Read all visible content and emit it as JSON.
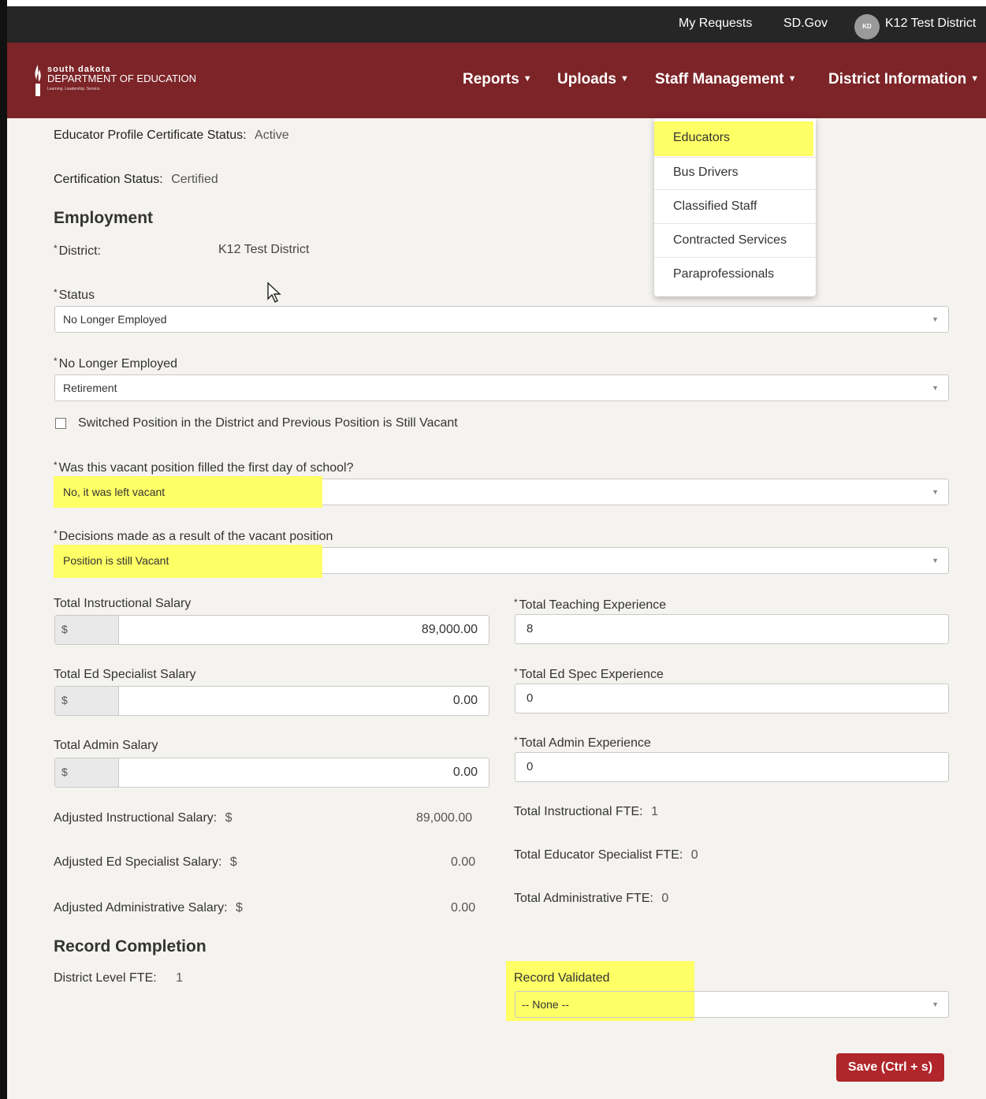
{
  "topbar": {
    "my_requests": "My Requests",
    "sd_gov": "SD.Gov",
    "avatar_initials": "KD",
    "user_name": "K12 Test District"
  },
  "logo": {
    "line1": "south dakota",
    "line2": "DEPARTMENT OF EDUCATION",
    "tagline": "Learning. Leadership. Service."
  },
  "nav": {
    "reports": "Reports",
    "uploads": "Uploads",
    "staff_management": "Staff Management",
    "district_information": "District Information"
  },
  "staff_menu": {
    "items": [
      "Educators",
      "Bus Drivers",
      "Classified Staff",
      "Contracted Services",
      "Paraprofessionals"
    ],
    "highlighted": "Educators"
  },
  "profile": {
    "cert_status_label": "Educator Profile Certificate Status:",
    "cert_status_value": "Active",
    "certification_label": "Certification Status:",
    "certification_value": "Certified"
  },
  "employment": {
    "heading": "Employment",
    "district_label": "District:",
    "district_value": "K12 Test District",
    "status_label": "Status",
    "status_value": "No Longer Employed",
    "nle_label": "No Longer Employed",
    "nle_value": "Retirement",
    "switched_label": "Switched Position in the District and Previous Position is Still Vacant",
    "vacant_filled_label": "Was this vacant position filled the first day of school?",
    "vacant_filled_value": "No, it was left vacant",
    "decisions_label": "Decisions made as a result of the vacant position",
    "decisions_value": "Position is still Vacant"
  },
  "salary": {
    "currency": "$",
    "instructional_label": "Total Instructional Salary",
    "instructional_value": "89,000.00",
    "ed_spec_label": "Total Ed Specialist Salary",
    "ed_spec_value": "0.00",
    "admin_label": "Total Admin Salary",
    "admin_value": "0.00",
    "teaching_exp_label": "Total Teaching Experience",
    "teaching_exp_value": "8",
    "ed_spec_exp_label": "Total Ed Spec Experience",
    "ed_spec_exp_value": "0",
    "admin_exp_label": "Total Admin Experience",
    "admin_exp_value": "0"
  },
  "adjusted": {
    "instructional_label": "Adjusted Instructional Salary:",
    "instructional_value": "89,000.00",
    "ed_spec_label": "Adjusted Ed Specialist Salary:",
    "ed_spec_value": "0.00",
    "admin_label": "Adjusted Administrative Salary:",
    "admin_value": "0.00",
    "currency": "$"
  },
  "fte": {
    "instructional_label": "Total Instructional FTE:",
    "instructional_value": "1",
    "educator_spec_label": "Total Educator Specialist FTE:",
    "educator_spec_value": "0",
    "admin_label": "Total Administrative FTE:",
    "admin_value": "0"
  },
  "record": {
    "heading": "Record Completion",
    "district_fte_label": "District Level FTE:",
    "district_fte_value": "1",
    "validated_label": "Record Validated",
    "validated_value": "-- None --"
  },
  "save_label": "Save (Ctrl + s)",
  "colors": {
    "brand": "#7c2427",
    "save": "#b0262a",
    "highlight": "#ffff66"
  }
}
